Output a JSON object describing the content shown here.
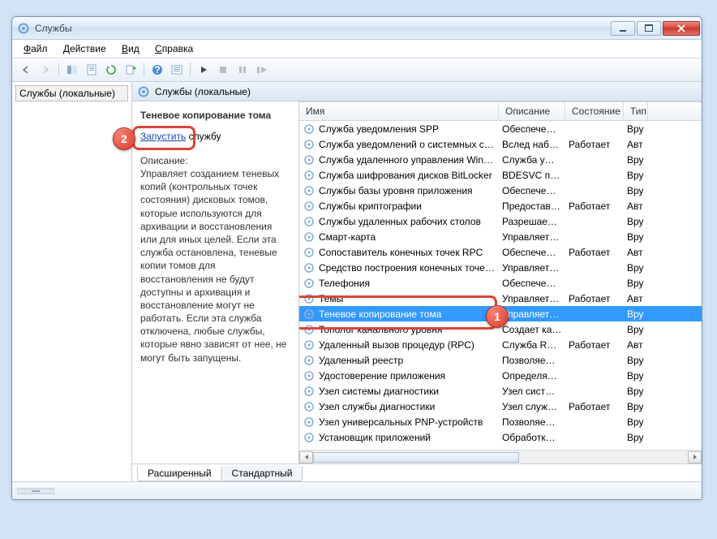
{
  "window": {
    "title": "Службы"
  },
  "menubar": {
    "file": "Файл",
    "action": "Действие",
    "view": "Вид",
    "help": "Справка"
  },
  "left_tree": {
    "root": "Службы (локальные)"
  },
  "right_header": {
    "title": "Службы (локальные)"
  },
  "detail": {
    "service_name": "Теневое копирование тома",
    "start_link": "Запустить",
    "after_link": " службу",
    "desc_label": "Описание:",
    "description": "Управляет созданием теневых копий (контрольных точек состояния) дисковых томов, которые используются для архивации и восстановления или для иных целей. Если эта служба остановлена, теневые копии томов для восстановления не будут доступны и архивация и восстановление могут не работать. Если эта служба отключена, любые службы, которые явно зависят от нее, не могут быть запущены."
  },
  "columns": {
    "name": "Имя",
    "description": "Описание",
    "state": "Состояние",
    "startup": "Тип"
  },
  "col_widths": {
    "name": 246,
    "description": 82,
    "state": 72,
    "startup": 30
  },
  "services": [
    {
      "name": "Служба уведомления SPP",
      "desc": "Обеспече…",
      "state": "",
      "type": "Вру"
    },
    {
      "name": "Служба уведомлений о системных соб…",
      "desc": "Вслед наб…",
      "state": "Работает",
      "type": "Авт"
    },
    {
      "name": "Служба удаленного управления Windo…",
      "desc": "Служба у…",
      "state": "",
      "type": "Вру"
    },
    {
      "name": "Служба шифрования дисков BitLocker",
      "desc": "BDESVC пр…",
      "state": "",
      "type": "Вру"
    },
    {
      "name": "Службы базы уровня приложения",
      "desc": "Обеспече…",
      "state": "",
      "type": "Вру"
    },
    {
      "name": "Службы криптографии",
      "desc": "Предостав…",
      "state": "Работает",
      "type": "Авт"
    },
    {
      "name": "Службы удаленных рабочих столов",
      "desc": "Разрешае…",
      "state": "",
      "type": "Вру"
    },
    {
      "name": "Смарт-карта",
      "desc": "Управляет…",
      "state": "",
      "type": "Вру"
    },
    {
      "name": "Сопоставитель конечных точек RPC",
      "desc": "Обеспече…",
      "state": "Работает",
      "type": "Авт"
    },
    {
      "name": "Средство построения конечных точек …",
      "desc": "Управляет…",
      "state": "",
      "type": "Вру"
    },
    {
      "name": "Телефония",
      "desc": "Обеспече…",
      "state": "",
      "type": "Вру"
    },
    {
      "name": "Темы",
      "desc": "Управляет…",
      "state": "Работает",
      "type": "Авт"
    },
    {
      "name": "Теневое копирование тома",
      "desc": "Управляет…",
      "state": "",
      "type": "Вру",
      "selected": true
    },
    {
      "name": "Тополог канального уровня",
      "desc": "Создает ка…",
      "state": "",
      "type": "Вру"
    },
    {
      "name": "Удаленный вызов процедур (RPC)",
      "desc": "Служба R…",
      "state": "Работает",
      "type": "Авт"
    },
    {
      "name": "Удаленный реестр",
      "desc": "Позволяе…",
      "state": "",
      "type": "Вру"
    },
    {
      "name": "Удостоверение приложения",
      "desc": "Определя…",
      "state": "",
      "type": "Вру"
    },
    {
      "name": "Узел системы диагностики",
      "desc": "Узел сист…",
      "state": "",
      "type": "Вру"
    },
    {
      "name": "Узел службы диагностики",
      "desc": "Узел служ…",
      "state": "Работает",
      "type": "Вру"
    },
    {
      "name": "Узел универсальных PNP-устройств",
      "desc": "Позволяе…",
      "state": "",
      "type": "Вру"
    },
    {
      "name": "Установщик приложений",
      "desc": "Обработк…",
      "state": "",
      "type": "Вру"
    }
  ],
  "tabs": {
    "extended": "Расширенный",
    "standard": "Стандартный"
  },
  "callouts": {
    "one": "1",
    "two": "2"
  }
}
